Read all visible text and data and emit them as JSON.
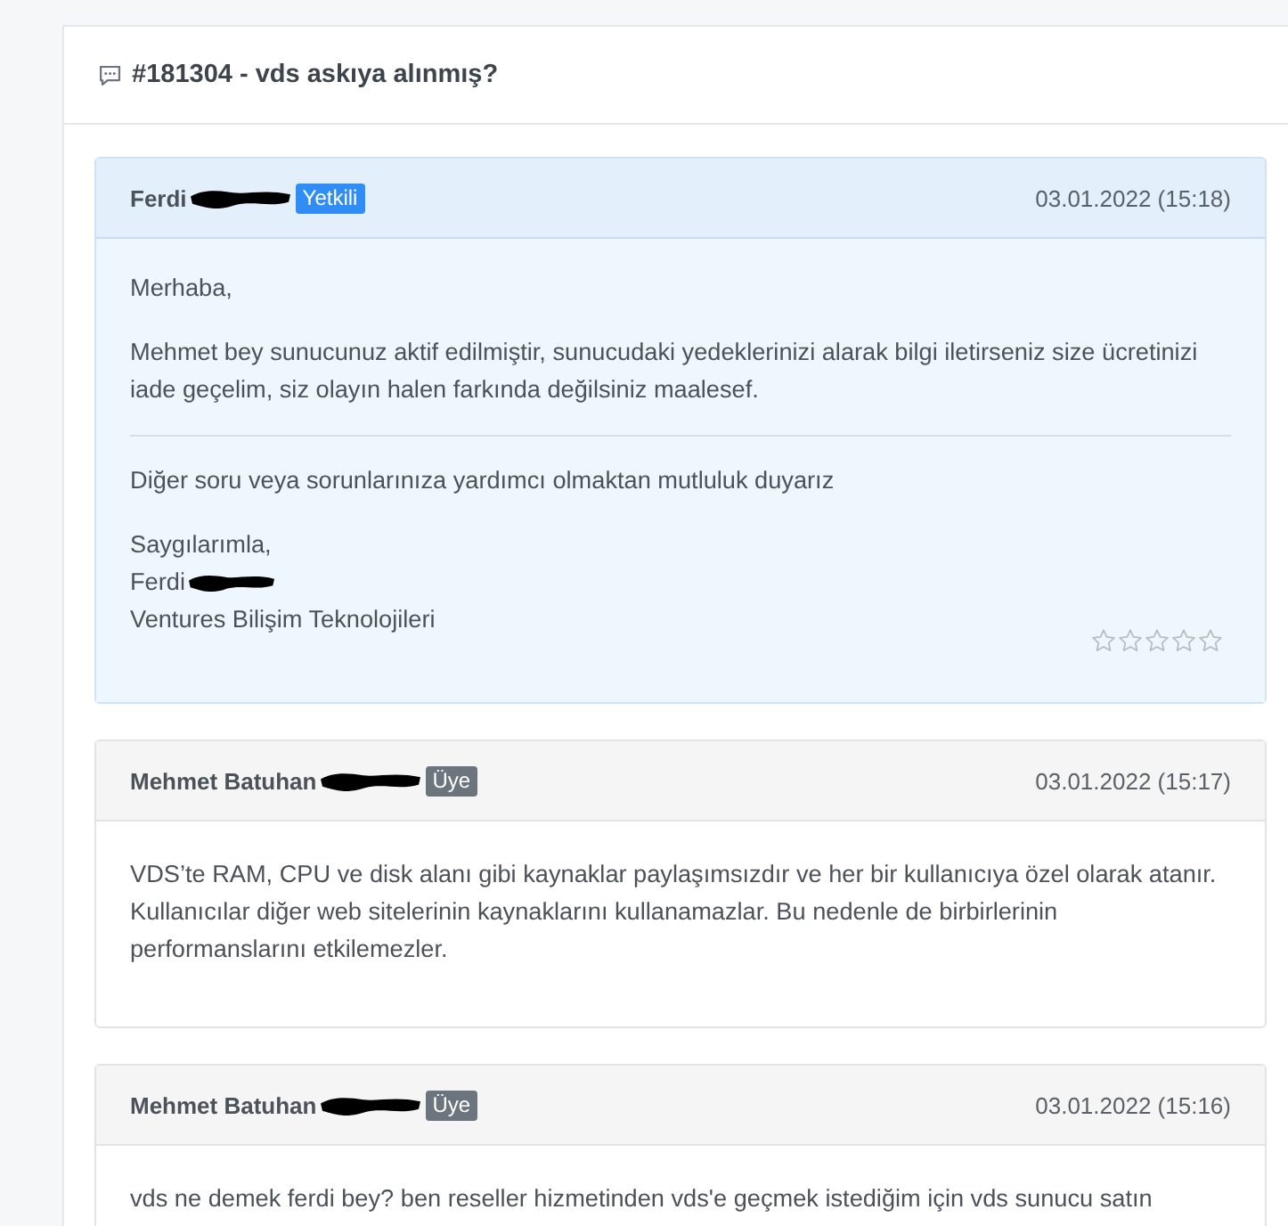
{
  "ticket": {
    "title": "#181304 - vds askıya alınmış?"
  },
  "messages": [
    {
      "kind": "staff",
      "author": "Ferdi",
      "redacted": true,
      "badge": "Yetkili",
      "date": "03.01.2022 (15:18)",
      "body": [
        {
          "kind": "text",
          "text": "Merhaba,"
        },
        {
          "kind": "text",
          "text": "Mehmet bey sunucunuz aktif edilmiştir, sunucudaki yedeklerinizi alarak bilgi iletirseniz size ücretinizi iade geçelim, siz olayın halen farkında değilsiniz maalesef."
        },
        {
          "kind": "divider"
        },
        {
          "kind": "text",
          "text": "Diğer soru veya sorunlarınıza yardımcı olmaktan mutluluk duyarız"
        }
      ],
      "signature": [
        {
          "text": "Saygılarımla,",
          "redacted": false
        },
        {
          "text": "Ferdi",
          "redacted": true
        },
        {
          "text": "Ventures Bilişim Teknolojileri",
          "redacted": false
        }
      ],
      "stars": 0
    },
    {
      "kind": "member",
      "author": "Mehmet Batuhan",
      "redacted": true,
      "badge": "Üye",
      "date": "03.01.2022 (15:17)",
      "body": [
        {
          "kind": "text",
          "text": "VDS’te RAM, CPU ve disk alanı gibi kaynaklar paylaşımsızdır ve her bir kullanıcıya özel olarak atanır. Kullanıcılar diğer web sitelerinin kaynaklarını kullanamazlar. Bu nedenle de birbirlerinin performanslarını etkilemezler."
        }
      ]
    },
    {
      "kind": "member",
      "author": "Mehmet Batuhan",
      "redacted": true,
      "badge": "Üye",
      "date": "03.01.2022 (15:16)",
      "body": [
        {
          "kind": "text",
          "text": "vds ne demek ferdi bey? ben reseller hizmetinden vds'e geçmek istediğim için vds sunucu satın"
        }
      ]
    }
  ]
}
